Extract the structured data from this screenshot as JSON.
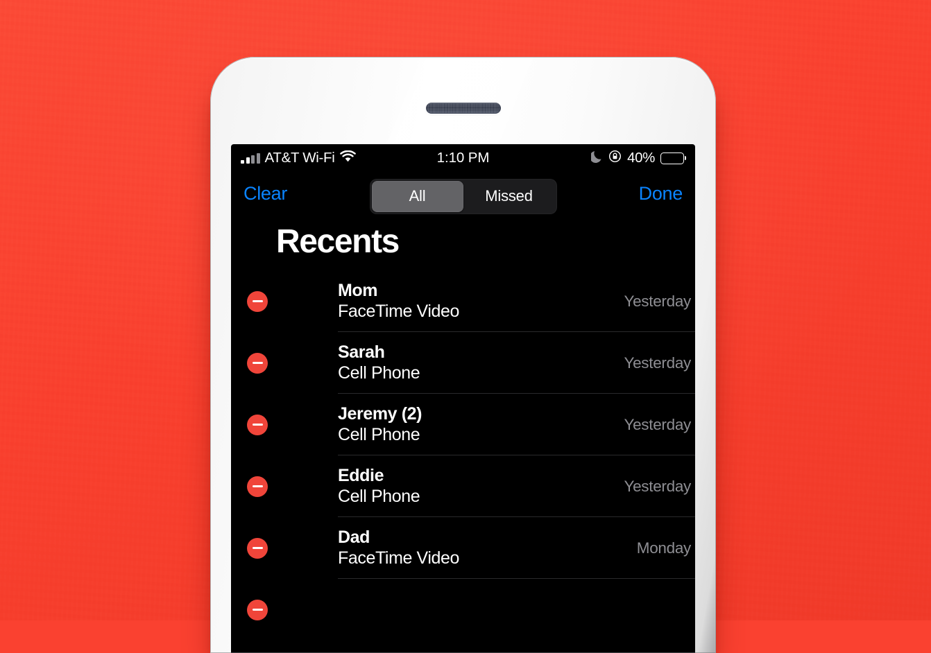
{
  "device": {
    "frame_color": "#ffffff",
    "backdrop_color": "#fa4130",
    "earpiece_icon": "speaker-grille-icon"
  },
  "status_bar": {
    "signal_icon": "cellular-signal-icon",
    "carrier": "AT&T Wi-Fi",
    "wifi_icon": "wifi-icon",
    "time": "1:10 PM",
    "dnd_icon": "moon-do-not-disturb-icon",
    "rotation_lock_icon": "rotation-lock-icon",
    "battery_percent": "40%",
    "battery_level": 40,
    "battery_color": "#ffd60a"
  },
  "nav_bar": {
    "clear_label": "Clear",
    "done_label": "Done",
    "accent_color": "#0a84ff",
    "segments": [
      {
        "label": "All",
        "selected": true
      },
      {
        "label": "Missed",
        "selected": false
      }
    ],
    "segment_selected_color": "#636366",
    "segment_track_color": "#1c1c1e"
  },
  "main": {
    "title": "Recents",
    "delete_button_color": "#f0453a",
    "delete_icon": "minus-circle-icon",
    "calls": [
      {
        "name": "Mom",
        "type": "FaceTime Video",
        "time": "Yesterday"
      },
      {
        "name": "Sarah",
        "type": "Cell Phone",
        "time": "Yesterday"
      },
      {
        "name": "Jeremy (2)",
        "type": "Cell Phone",
        "time": "Yesterday"
      },
      {
        "name": "Eddie",
        "type": "Cell Phone",
        "time": "Yesterday"
      },
      {
        "name": "Dad",
        "type": "FaceTime Video",
        "time": "Monday"
      }
    ]
  }
}
